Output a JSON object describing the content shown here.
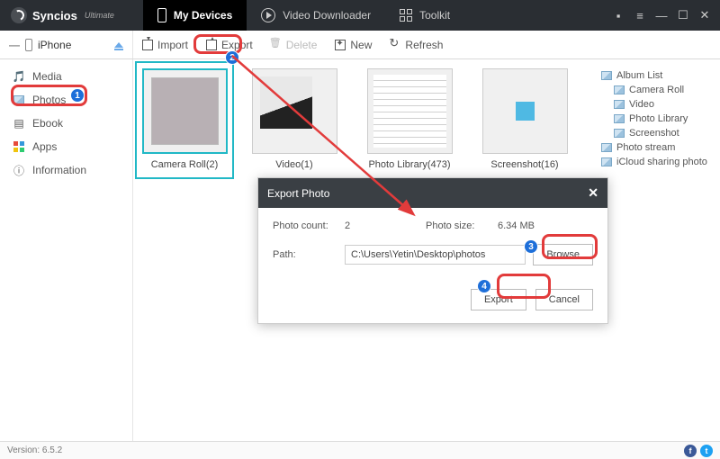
{
  "app": {
    "brand": "Syncios",
    "edition": "Ultimate"
  },
  "topTabs": {
    "devices": "My Devices",
    "downloader": "Video Downloader",
    "toolkit": "Toolkit"
  },
  "device": {
    "name": "iPhone"
  },
  "toolbar": {
    "import": "Import",
    "export": "Export",
    "delete": "Delete",
    "new": "New",
    "refresh": "Refresh"
  },
  "sidebar": {
    "media": "Media",
    "photos": "Photos",
    "ebook": "Ebook",
    "apps": "Apps",
    "information": "Information"
  },
  "thumbs": {
    "cameraRoll": "Camera Roll(2)",
    "video": "Video(1)",
    "photoLibrary": "Photo Library(473)",
    "screenshot": "Screenshot(16)"
  },
  "albumPanel": {
    "albumList": "Album List",
    "cameraRoll": "Camera Roll",
    "video": "Video",
    "photoLibrary": "Photo Library",
    "screenshot": "Screenshot",
    "photoStream": "Photo stream",
    "icloud": "iCloud sharing photo"
  },
  "modal": {
    "title": "Export Photo",
    "countLabel": "Photo count:",
    "countValue": "2",
    "sizeLabel": "Photo size:",
    "sizeValue": "6.34 MB",
    "pathLabel": "Path:",
    "pathValue": "C:\\Users\\Yetin\\Desktop\\photos",
    "browse": "Browse",
    "export": "Export",
    "cancel": "Cancel"
  },
  "footer": {
    "version": "Version: 6.5.2"
  },
  "badges": {
    "b1": "1",
    "b2": "2",
    "b3": "3",
    "b4": "4"
  }
}
